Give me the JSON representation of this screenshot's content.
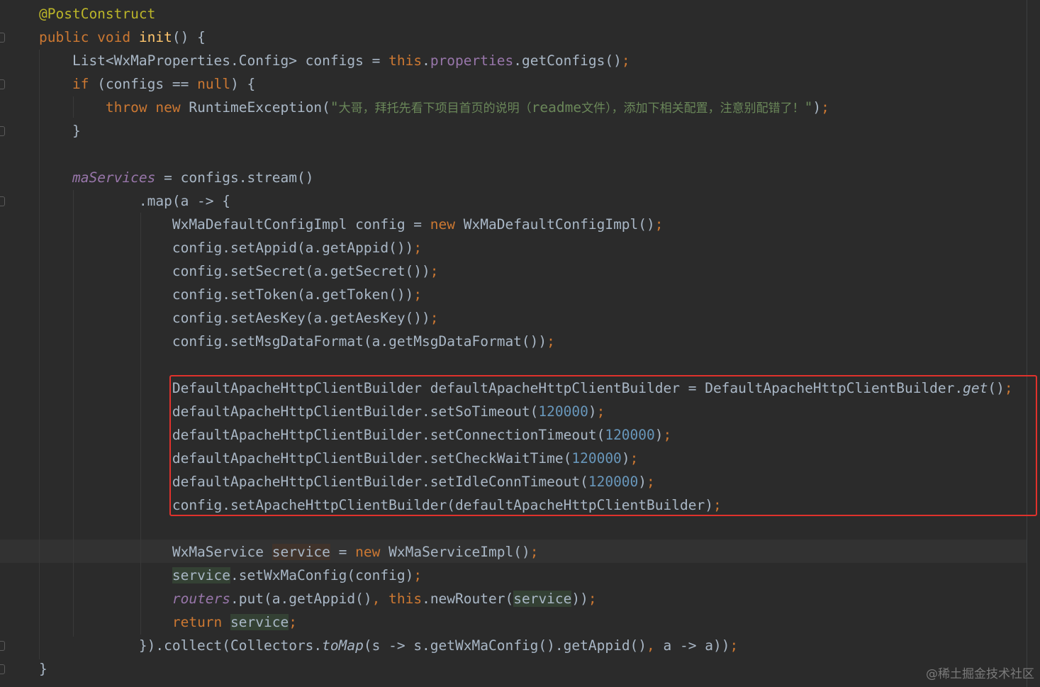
{
  "editor": {
    "lines": [
      {
        "segments": [
          {
            "t": "@PostConstruct",
            "c": "ann"
          }
        ]
      },
      {
        "segments": [
          {
            "t": "public void ",
            "c": "kw"
          },
          {
            "t": "init",
            "c": "fn-decl"
          },
          {
            "t": "() {",
            "c": ""
          }
        ]
      },
      {
        "segments": [
          {
            "t": "    List<WxMaProperties.Config> configs = ",
            "c": ""
          },
          {
            "t": "this",
            "c": "kw"
          },
          {
            "t": ".",
            "c": ""
          },
          {
            "t": "properties",
            "c": "fld"
          },
          {
            "t": ".getConfigs()",
            "c": ""
          },
          {
            "t": ";",
            "c": "semi"
          }
        ]
      },
      {
        "segments": [
          {
            "t": "    ",
            "c": ""
          },
          {
            "t": "if ",
            "c": "kw"
          },
          {
            "t": "(configs == ",
            "c": ""
          },
          {
            "t": "null",
            "c": "kw"
          },
          {
            "t": ") {",
            "c": ""
          }
        ]
      },
      {
        "segments": [
          {
            "t": "        ",
            "c": ""
          },
          {
            "t": "throw new ",
            "c": "kw"
          },
          {
            "t": "RuntimeException(",
            "c": ""
          },
          {
            "t": "\"",
            "c": "str"
          },
          {
            "t": "大哥，拜托先看下项目首页的说明（",
            "c": "cjk"
          },
          {
            "t": "readme",
            "c": "str"
          },
          {
            "t": "文件），添加下相关配置，注意别配错了！",
            "c": "cjk"
          },
          {
            "t": "\"",
            "c": "str"
          },
          {
            "t": ")",
            "c": ""
          },
          {
            "t": ";",
            "c": "semi"
          }
        ]
      },
      {
        "segments": [
          {
            "t": "    }",
            "c": ""
          }
        ]
      },
      {
        "segments": []
      },
      {
        "segments": [
          {
            "t": "    ",
            "c": ""
          },
          {
            "t": "maServices",
            "c": "fld-i"
          },
          {
            "t": " = configs.stream()",
            "c": ""
          }
        ]
      },
      {
        "segments": [
          {
            "t": "            .map(a -> {",
            "c": ""
          }
        ]
      },
      {
        "segments": [
          {
            "t": "                WxMaDefaultConfigImpl config = ",
            "c": ""
          },
          {
            "t": "new ",
            "c": "kw"
          },
          {
            "t": "WxMaDefaultConfigImpl()",
            "c": ""
          },
          {
            "t": ";",
            "c": "semi"
          }
        ]
      },
      {
        "segments": [
          {
            "t": "                config.setAppid(a.getAppid())",
            "c": ""
          },
          {
            "t": ";",
            "c": "semi"
          }
        ]
      },
      {
        "segments": [
          {
            "t": "                config.setSecret(a.getSecret())",
            "c": ""
          },
          {
            "t": ";",
            "c": "semi"
          }
        ]
      },
      {
        "segments": [
          {
            "t": "                config.setToken(a.getToken())",
            "c": ""
          },
          {
            "t": ";",
            "c": "semi"
          }
        ]
      },
      {
        "segments": [
          {
            "t": "                config.setAesKey(a.getAesKey())",
            "c": ""
          },
          {
            "t": ";",
            "c": "semi"
          }
        ]
      },
      {
        "segments": [
          {
            "t": "                config.setMsgDataFormat(a.getMsgDataFormat())",
            "c": ""
          },
          {
            "t": ";",
            "c": "semi"
          }
        ]
      },
      {
        "segments": []
      },
      {
        "segments": [
          {
            "t": "                DefaultApacheHttpClientBuilder defaultApacheHttpClientBuilder = DefaultApacheHttpClientBuilder.",
            "c": ""
          },
          {
            "t": "get",
            "c": "static-i"
          },
          {
            "t": "()",
            "c": ""
          },
          {
            "t": ";",
            "c": "semi"
          }
        ]
      },
      {
        "segments": [
          {
            "t": "                defaultApacheHttpClientBuilder.setSoTimeout(",
            "c": ""
          },
          {
            "t": "120000",
            "c": "num"
          },
          {
            "t": ")",
            "c": ""
          },
          {
            "t": ";",
            "c": "semi"
          }
        ]
      },
      {
        "segments": [
          {
            "t": "                defaultApacheHttpClientBuilder.setConnectionTimeout(",
            "c": ""
          },
          {
            "t": "120000",
            "c": "num"
          },
          {
            "t": ")",
            "c": ""
          },
          {
            "t": ";",
            "c": "semi"
          }
        ]
      },
      {
        "segments": [
          {
            "t": "                defaultApacheHttpClientBuilder.setCheckWaitTime(",
            "c": ""
          },
          {
            "t": "120000",
            "c": "num"
          },
          {
            "t": ")",
            "c": ""
          },
          {
            "t": ";",
            "c": "semi"
          }
        ]
      },
      {
        "segments": [
          {
            "t": "                defaultApacheHttpClientBuilder.setIdleConnTimeout(",
            "c": ""
          },
          {
            "t": "120000",
            "c": "num"
          },
          {
            "t": ")",
            "c": ""
          },
          {
            "t": ";",
            "c": "semi"
          }
        ]
      },
      {
        "segments": [
          {
            "t": "                config.setApacheHttpClientBuilder(defaultApacheHttpClientBuilder)",
            "c": ""
          },
          {
            "t": ";",
            "c": "semi"
          }
        ]
      },
      {
        "segments": []
      },
      {
        "segments": [
          {
            "t": "                WxMaService ",
            "c": ""
          },
          {
            "t": "service",
            "c": "hl-decl"
          },
          {
            "t": " = ",
            "c": ""
          },
          {
            "t": "new ",
            "c": "kw"
          },
          {
            "t": "WxMaServiceImpl()",
            "c": ""
          },
          {
            "t": ";",
            "c": "semi"
          }
        ]
      },
      {
        "segments": [
          {
            "t": "                ",
            "c": ""
          },
          {
            "t": "service",
            "c": "hl-var"
          },
          {
            "t": ".setWxMaConfig(config)",
            "c": ""
          },
          {
            "t": ";",
            "c": "semi"
          }
        ]
      },
      {
        "segments": [
          {
            "t": "                ",
            "c": ""
          },
          {
            "t": "routers",
            "c": "fld-i"
          },
          {
            "t": ".put(a.getAppid()",
            "c": ""
          },
          {
            "t": ", ",
            "c": "semi"
          },
          {
            "t": "this",
            "c": "kw"
          },
          {
            "t": ".newRouter(",
            "c": ""
          },
          {
            "t": "service",
            "c": "hl-var"
          },
          {
            "t": "))",
            "c": ""
          },
          {
            "t": ";",
            "c": "semi"
          }
        ]
      },
      {
        "segments": [
          {
            "t": "                ",
            "c": ""
          },
          {
            "t": "return ",
            "c": "kw"
          },
          {
            "t": "service",
            "c": "hl-var"
          },
          {
            "t": ";",
            "c": "semi"
          }
        ]
      },
      {
        "segments": [
          {
            "t": "            }).collect(Collectors.",
            "c": ""
          },
          {
            "t": "toMap",
            "c": "static-i"
          },
          {
            "t": "(s -> s.getWxMaConfig().getAppid()",
            "c": ""
          },
          {
            "t": ", ",
            "c": "semi"
          },
          {
            "t": "a -> a))",
            "c": ""
          },
          {
            "t": ";",
            "c": "semi"
          }
        ]
      },
      {
        "segments": [
          {
            "t": "}",
            "c": ""
          }
        ]
      }
    ]
  },
  "watermark": "@稀土掘金技术社区",
  "colors": {
    "background": "#2b2b2b",
    "keyword": "#cc7832",
    "annotation": "#bbb529",
    "method_declaration": "#ffc66d",
    "field": "#9876aa",
    "number": "#6897bb",
    "string": "#6a8759",
    "default_text": "#a9b7c6",
    "highlight_box": "#e0322c"
  }
}
